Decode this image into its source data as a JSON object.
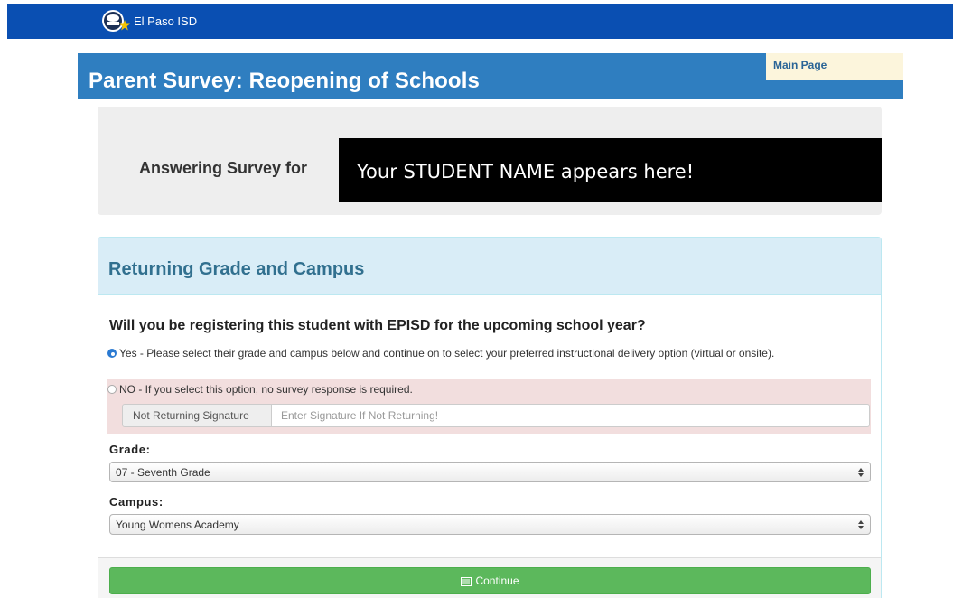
{
  "header": {
    "brand_name": "El Paso ISD",
    "logo_icon": "episd-globe-star-logo",
    "background_color": "#0a4fb2"
  },
  "page": {
    "title": "Parent Survey: Reopening of Schools",
    "main_page_link": "Main Page"
  },
  "student": {
    "answering_label": "Answering Survey for",
    "name_placeholder": "Your STUDENT NAME appears here!"
  },
  "panel": {
    "title": "Returning Grade and Campus",
    "question": "Will you be registering this student with EPISD for the upcoming school year?",
    "options": [
      {
        "label": "Yes - Please select their grade and campus below and continue on to select your preferred instructional delivery option (virtual or onsite).",
        "checked": true
      },
      {
        "label": "NO - If you select this option, no survey response is required.",
        "checked": false
      }
    ],
    "signature": {
      "addon_label": "Not Returning Signature",
      "placeholder": "Enter Signature If Not Returning!",
      "value": ""
    },
    "grade": {
      "label": "Grade:",
      "selected": "07 - Seventh Grade"
    },
    "campus": {
      "label": "Campus:",
      "selected": "Young Womens Academy"
    },
    "continue_label": "Continue",
    "continue_icon": "list-icon"
  },
  "colors": {
    "title_bar": "#2f7ec0",
    "panel_heading": "#d9edf7",
    "no_option_highlight": "#f2dede",
    "continue_button": "#5cb85c"
  }
}
